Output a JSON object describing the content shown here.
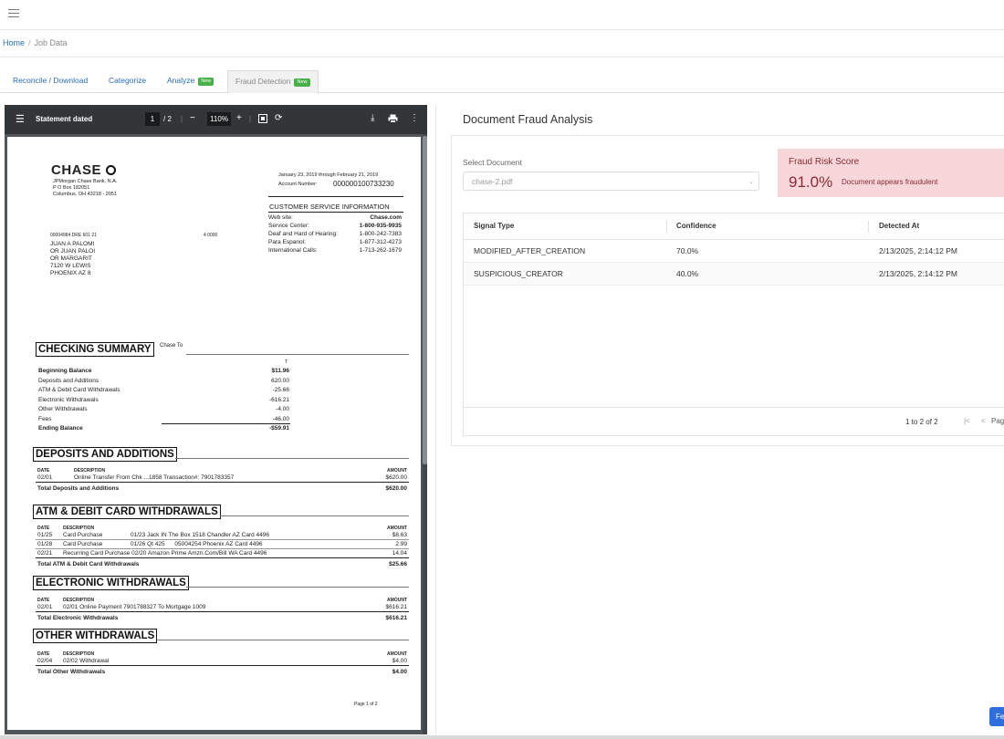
{
  "breadcrumb": {
    "home": "Home",
    "sep": "/",
    "current": "Job Data"
  },
  "tabs": [
    {
      "label": "Reconcile / Download",
      "badge": ""
    },
    {
      "label": "Categorize",
      "badge": ""
    },
    {
      "label": "Analyze",
      "badge": "New"
    },
    {
      "label": "Fraud Detection",
      "badge": "New"
    }
  ],
  "viewer": {
    "title": "Statement dated",
    "page": "1",
    "pages": "/ 2",
    "zoom": "110%"
  },
  "statement": {
    "bank_name": "CHASE",
    "bank_addr": [
      "JPMorgan Chase Bank, N.A.",
      "P O Box 182051",
      "Columbus, OH 43218 - 2051"
    ],
    "period": "January 23, 2019 through February 21, 2019",
    "account_label": "Account Number:",
    "account_number": "000000100733230",
    "cs_title": "CUSTOMER SERVICE INFORMATION",
    "cs_rows": [
      {
        "k": "Web site:",
        "v": "Chase.com"
      },
      {
        "k": "Service Center:",
        "v": "1-800-935-9935"
      },
      {
        "k": "Deaf and Hard of Hearing:",
        "v": "1-800-242-7383"
      },
      {
        "k": "Para Espanol:",
        "v": "1-877-312-4273"
      },
      {
        "k": "International Calls:",
        "v": "1-713-262-1679"
      }
    ],
    "mail_code": "00004984 DRE 601 21",
    "mail_code2": "4 0000",
    "customer": [
      "JUAN A PALOMI",
      "OR JUAN PALOI",
      "OR MARGARIT",
      "7120 W LEWIS",
      "PHOENIX AZ 8"
    ],
    "summary_title": "CHECKING SUMMARY",
    "summary_sub": "Chase To",
    "summary_t": "T",
    "summary": [
      {
        "k": "Beginning Balance",
        "v": "$11.96",
        "bold": true
      },
      {
        "k": "Deposits and Additions",
        "v": "620.00",
        "bold": false
      },
      {
        "k": "ATM & Debit Card Withdrawals",
        "v": "-25.66",
        "bold": false
      },
      {
        "k": "Electronic Withdrawals",
        "v": "-616.21",
        "bold": false
      },
      {
        "k": "Other Withdrawals",
        "v": "-4.00",
        "bold": false
      },
      {
        "k": "Fees",
        "v": "-46.00",
        "bold": false
      },
      {
        "k": "Ending Balance",
        "v": "-$59.91",
        "bold": true
      }
    ],
    "h_date": "DATE",
    "h_desc": "DESCRIPTION",
    "h_amount": "AMOUNT",
    "deposits": {
      "title": "DEPOSITS AND ADDITIONS",
      "rows": [
        {
          "d": "02/01",
          "desc": "Online Transfer From Chk ...1858 Transaction#: 7901783357",
          "a": "$620.00"
        }
      ],
      "total_label": "Total Deposits and Additions",
      "total": "$620.00"
    },
    "atm": {
      "title": "ATM & DEBIT CARD WITHDRAWALS",
      "rows": [
        {
          "d": "01/25",
          "t": "Card Purchase",
          "desc": "01/23 Jack IN The Box 1518 Chandler AZ Card 4496",
          "a": "$8.63"
        },
        {
          "d": "01/28",
          "t": "Card Purchase",
          "desc": "01/26 Qt 425      05004254 Phoenix AZ Card 4496",
          "a": "2.99"
        },
        {
          "d": "02/21",
          "t": "Recurring Card Purchase 02/20 Amazon Prime Amzn.Com/Bill WA Card 4496",
          "desc": "",
          "a": "14.04"
        }
      ],
      "total_label": "Total ATM & Debit Card Withdrawals",
      "total": "$25.66"
    },
    "electronic": {
      "title": "ELECTRONIC WITHDRAWALS",
      "rows": [
        {
          "d": "02/01",
          "desc": "02/01 Online Payment 7901788327 To Mortgage 1009",
          "a": "$616.21"
        }
      ],
      "total_label": "Total Electronic Withdrawals",
      "total": "$616.21"
    },
    "other": {
      "title": "OTHER WITHDRAWALS",
      "rows": [
        {
          "d": "02/04",
          "desc": "02/02 Withdrawal",
          "a": "$4.00"
        }
      ],
      "total_label": "Total Other Withdrawals",
      "total": "$4.00"
    },
    "footer": "Page 1 of 2"
  },
  "analysis": {
    "title": "Document Fraud Analysis",
    "select_label": "Select Document",
    "select_value": "chase-2.pdf",
    "risk_label": "Fraud Risk Score",
    "risk_value": "91.0%",
    "risk_status": "Document appears fraudulent",
    "columns": [
      "Signal Type",
      "Confidence",
      "Detected At"
    ],
    "rows": [
      {
        "signal": "MODIFIED_AFTER_CREATION",
        "confidence": "70.0%",
        "detected": "2/13/2025, 2:14:12 PM"
      },
      {
        "signal": "SUSPICIOUS_CREATOR",
        "confidence": "40.0%",
        "detected": "2/13/2025, 2:14:12 PM"
      }
    ],
    "pager_count": "1 to 2 of 2",
    "pager_page": "Pag",
    "button_label": "Fe"
  },
  "colors": {
    "accent": "#2b6cb0",
    "risk_bg": "#f7d7da",
    "risk_text": "#8a2a33",
    "new_badge": "#48b04a",
    "button": "#2f6fdb"
  }
}
